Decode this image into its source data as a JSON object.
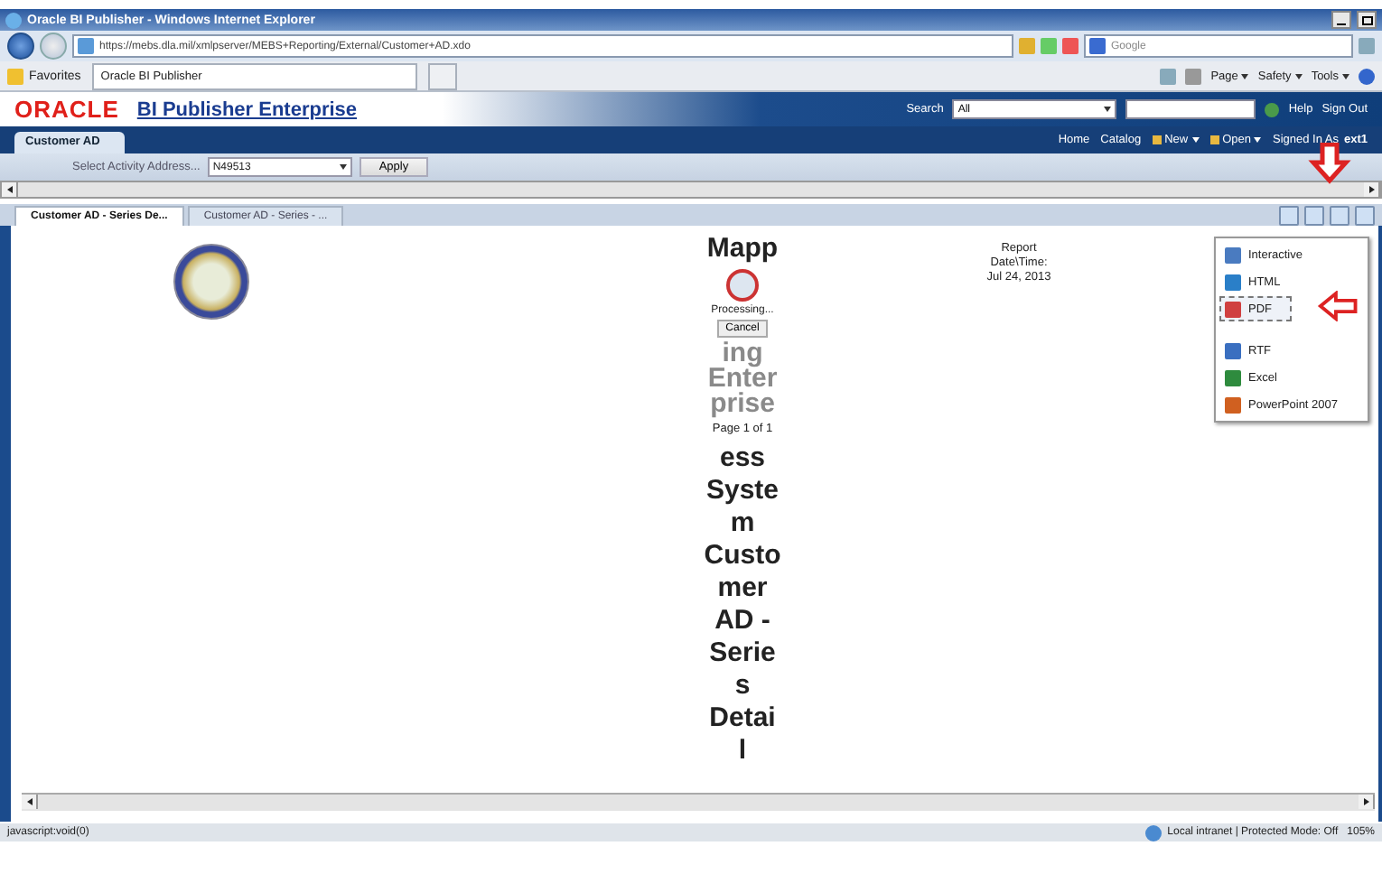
{
  "window": {
    "title": "Oracle BI Publisher - Windows Internet Explorer"
  },
  "address_bar": {
    "url": "https://mebs.dla.mil/xmlpserver/MEBS+Reporting/External/Customer+AD.xdo",
    "search_placeholder": "Google"
  },
  "favorites_bar": {
    "favorites_label": "Favorites",
    "tabs": [
      {
        "label": "Oracle BI Publisher",
        "selected": true
      }
    ],
    "commands": [
      "Page",
      "Safety",
      "Tools"
    ]
  },
  "app_header": {
    "logo": "ORACLE",
    "product": "BI Publisher Enterprise",
    "search_label": "Search",
    "search_scope": "All",
    "links": [
      "Help",
      "Sign Out"
    ]
  },
  "nav_bar": {
    "tab": "Customer AD",
    "links": [
      {
        "kind": "link",
        "label": "Home"
      },
      {
        "kind": "link",
        "label": "Catalog"
      },
      {
        "kind": "menu",
        "label": "New"
      },
      {
        "kind": "menu",
        "label": "Open"
      }
    ],
    "signed_in_label": "Signed In As",
    "user": "ext1"
  },
  "parameters": {
    "label": "Select Activity Address...",
    "value": "N49513",
    "apply": "Apply"
  },
  "report_tabs": [
    {
      "label": "Customer AD - Series De...",
      "selected": true
    },
    {
      "label": "Customer AD - Series - ...",
      "selected": false
    }
  ],
  "report": {
    "title_top": "Mapp",
    "faded_lines": [
      "ing",
      "Enter",
      "prise"
    ],
    "processing": "Processing...",
    "cancel": "Cancel",
    "page_info": "Page 1 of 1",
    "title_lines": [
      "ess",
      "Syste",
      "m",
      "Custo",
      "mer",
      "AD -",
      "Serie",
      "s",
      "Detai",
      "l"
    ],
    "date_lines": [
      "Report",
      "Date\\Time:",
      "Jul 24, 2013"
    ]
  },
  "output_menu": [
    {
      "label": "Interactive",
      "selected": false
    },
    {
      "label": "HTML",
      "selected": false
    },
    {
      "label": "PDF",
      "selected": true
    },
    {
      "label": "RTF",
      "selected": false
    },
    {
      "label": "Excel",
      "selected": false
    },
    {
      "label": "PowerPoint 2007",
      "selected": false
    }
  ],
  "status_bar": {
    "text": "javascript:void(0)",
    "zone": "Local intranet | Protected Mode: Off",
    "zoom": "105%"
  }
}
